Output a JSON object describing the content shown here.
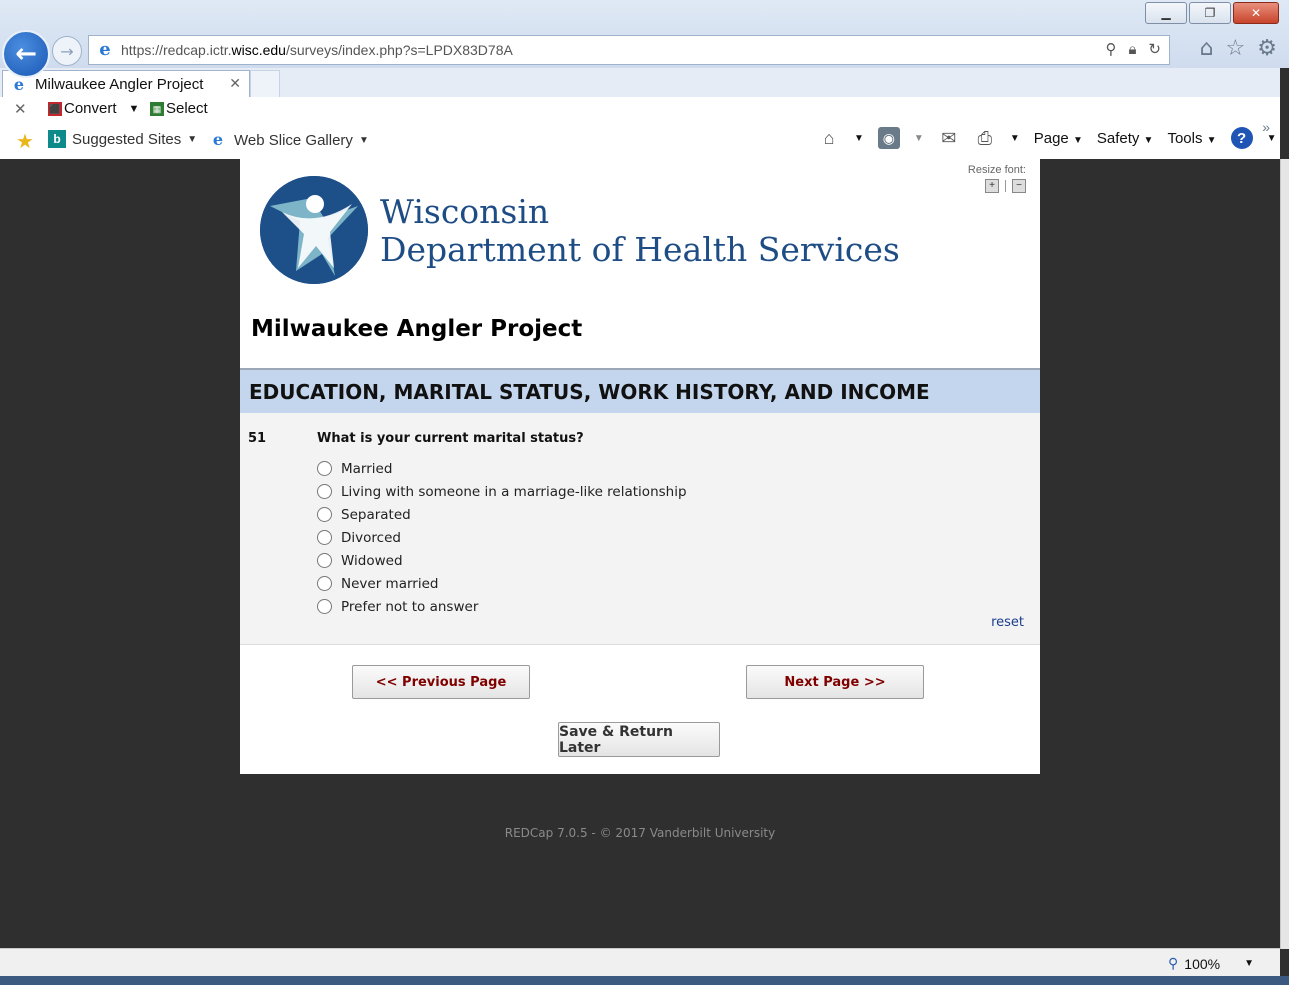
{
  "browser": {
    "url_prefix": "https://redcap.ictr.",
    "url_domain": "wisc.edu",
    "url_suffix": "/surveys/index.php?s=LPDX83D78A",
    "tab_title": "Milwaukee Angler Project",
    "cmd1": {
      "convert": "Convert",
      "select": "Select"
    },
    "favorites": {
      "suggested": "Suggested Sites",
      "webslice": "Web Slice Gallery"
    },
    "commands": {
      "page": "Page",
      "safety": "Safety",
      "tools": "Tools"
    },
    "zoom": "100%"
  },
  "page": {
    "resize_font_label": "Resize font:",
    "org_line1": "Wisconsin",
    "org_line2": "Department of Health Services",
    "project_title": "Milwaukee Angler Project",
    "section_header": "EDUCATION, MARITAL STATUS, WORK HISTORY, AND INCOME",
    "question": {
      "number": "51",
      "text": "What is your current marital status?",
      "options": [
        "Married",
        "Living with someone in a marriage-like relationship",
        "Separated",
        "Divorced",
        "Widowed",
        "Never married",
        "Prefer not to answer"
      ],
      "reset_label": "reset"
    },
    "prev_label": "<< Previous Page",
    "next_label": "Next Page >>",
    "save_label": "Save & Return Later"
  },
  "footer": "REDCap 7.0.5 - © 2017 Vanderbilt University"
}
